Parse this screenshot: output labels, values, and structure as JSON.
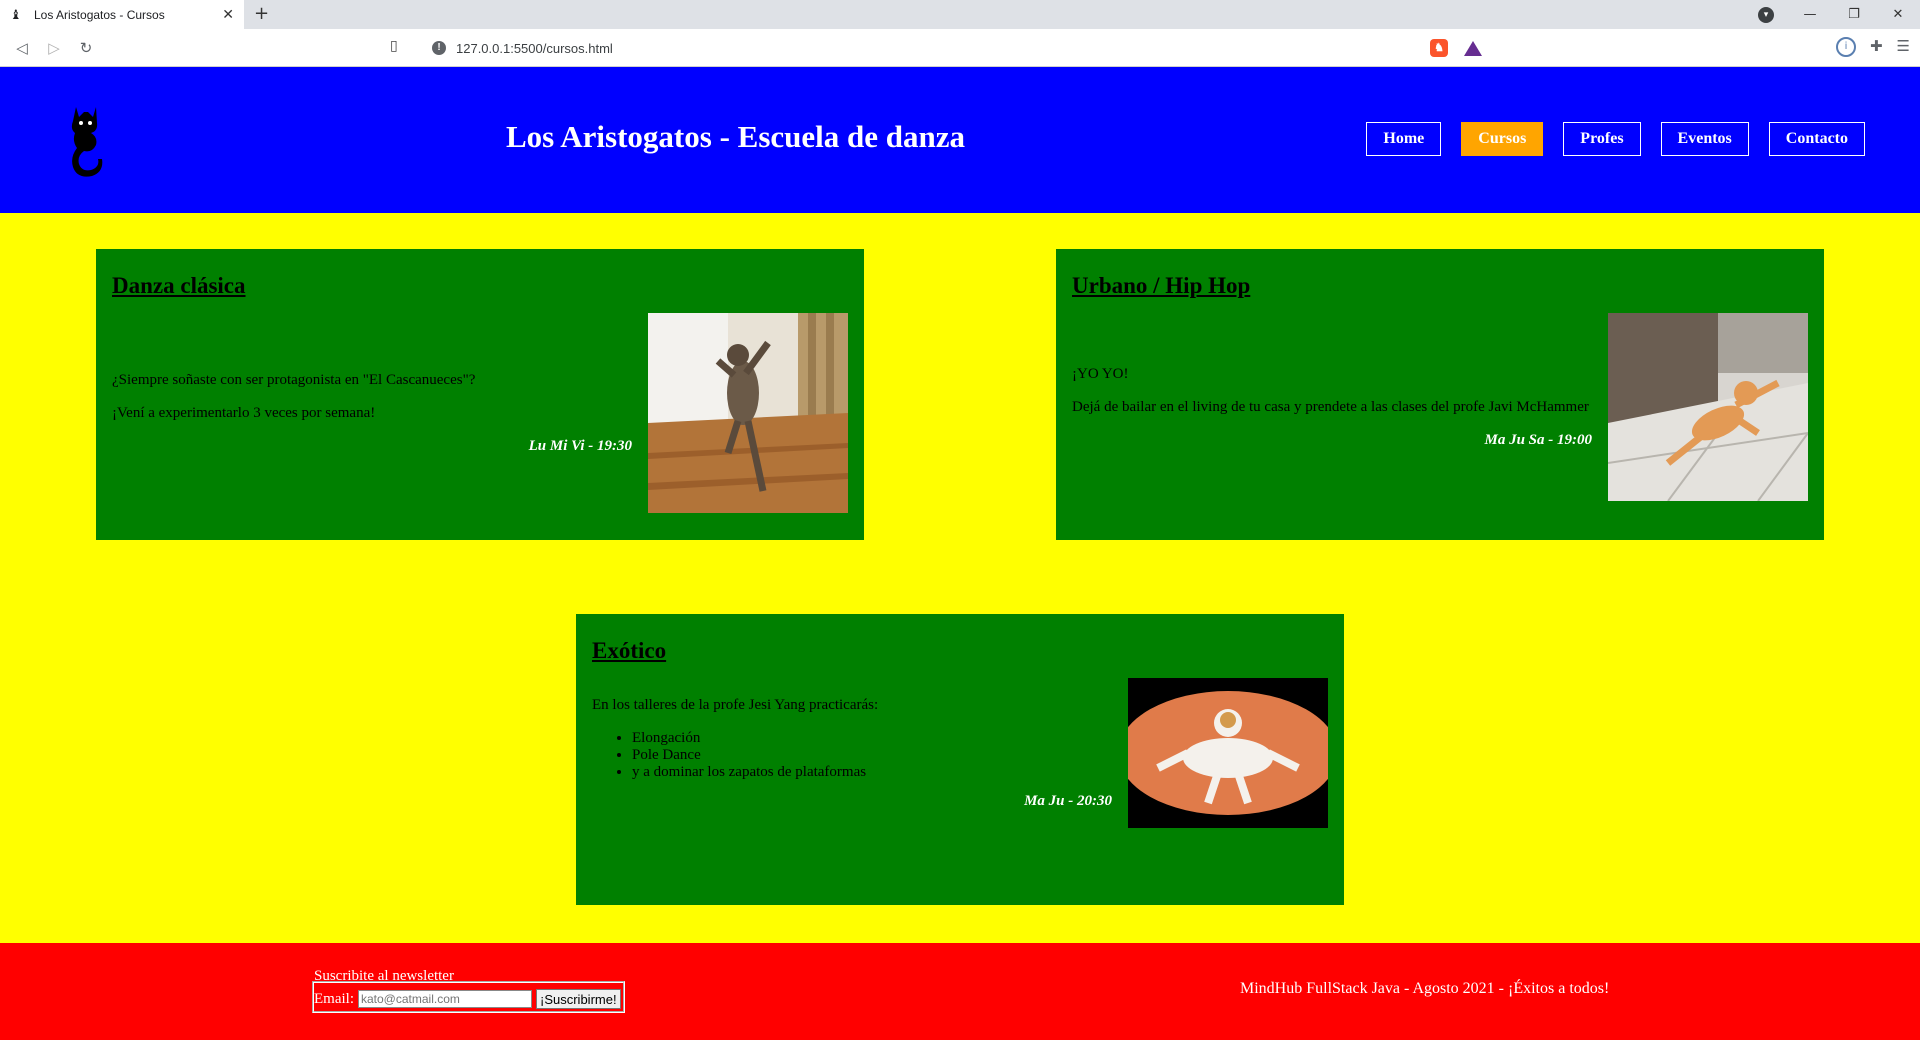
{
  "browser": {
    "tab_title": "Los Aristogatos - Cursos",
    "url": "127.0.0.1:5500/cursos.html"
  },
  "header": {
    "title": "Los Aristogatos - Escuela de danza",
    "nav": [
      "Home",
      "Cursos",
      "Profes",
      "Eventos",
      "Contacto"
    ],
    "active_nav": "Cursos"
  },
  "courses": [
    {
      "title": "Danza clásica",
      "paragraphs": [
        "¿Siempre soñaste con ser protagonista en \"El Cascanueces\"?",
        "¡Vení a experimentarlo 3 veces por semana!"
      ],
      "schedule": "Lu Mi Vi - 19:30"
    },
    {
      "title": "Urbano / Hip Hop",
      "paragraphs": [
        "¡YO YO!",
        "Dejá de bailar en el living de tu casa y prendete a las clases del profe Javi McHammer"
      ],
      "schedule": "Ma Ju Sa - 19:00"
    },
    {
      "title": "Exótico",
      "intro": "En los talleres de la profe Jesi Yang practicarás:",
      "items": [
        "Elongación",
        "Pole Dance",
        "y a dominar los zapatos de plataformas"
      ],
      "schedule": "Ma Ju - 20:30"
    }
  ],
  "footer": {
    "legend": "Suscribite al newsletter",
    "email_label": "Email:",
    "email_placeholder": "kato@catmail.com",
    "submit_label": "¡Suscribirme!",
    "credits": "MindHub FullStack Java - Agosto 2021 - ¡Éxitos a todos!"
  },
  "colors": {
    "header_bg": "#0000ff",
    "main_bg": "#ffff00",
    "card_bg": "#008000",
    "active_nav": "#ffa500",
    "footer_bg": "#ff0000"
  }
}
